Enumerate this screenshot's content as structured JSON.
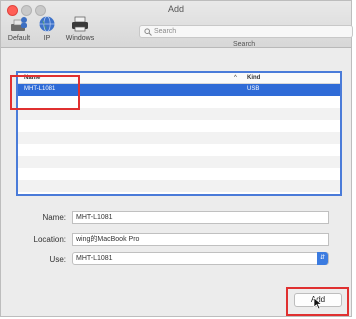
{
  "window": {
    "title": "Add"
  },
  "toolbar": {
    "items": [
      {
        "label": "Default",
        "icon": "printer-person-icon",
        "selected": true
      },
      {
        "label": "IP",
        "icon": "globe-icon"
      },
      {
        "label": "Windows",
        "icon": "printer-icon"
      }
    ],
    "search": {
      "placeholder": "Search",
      "label": "Search"
    }
  },
  "printer_list": {
    "headers": {
      "name": "Name",
      "kind": "Kind",
      "sort_indicator": "^"
    },
    "rows": [
      {
        "name": "MHT-L1081",
        "kind": "USB",
        "selected": true
      }
    ]
  },
  "form": {
    "name": {
      "label": "Name:",
      "value": "MHT-L1081"
    },
    "location": {
      "label": "Location:",
      "value": "wing的MacBook Pro"
    },
    "use": {
      "label": "Use:",
      "value": "MHT-L1081"
    }
  },
  "buttons": {
    "add": "Add"
  },
  "colors": {
    "selection": "#2f6bd7",
    "highlight_box": "#e03030",
    "list_focus": "#4a7bd9"
  }
}
